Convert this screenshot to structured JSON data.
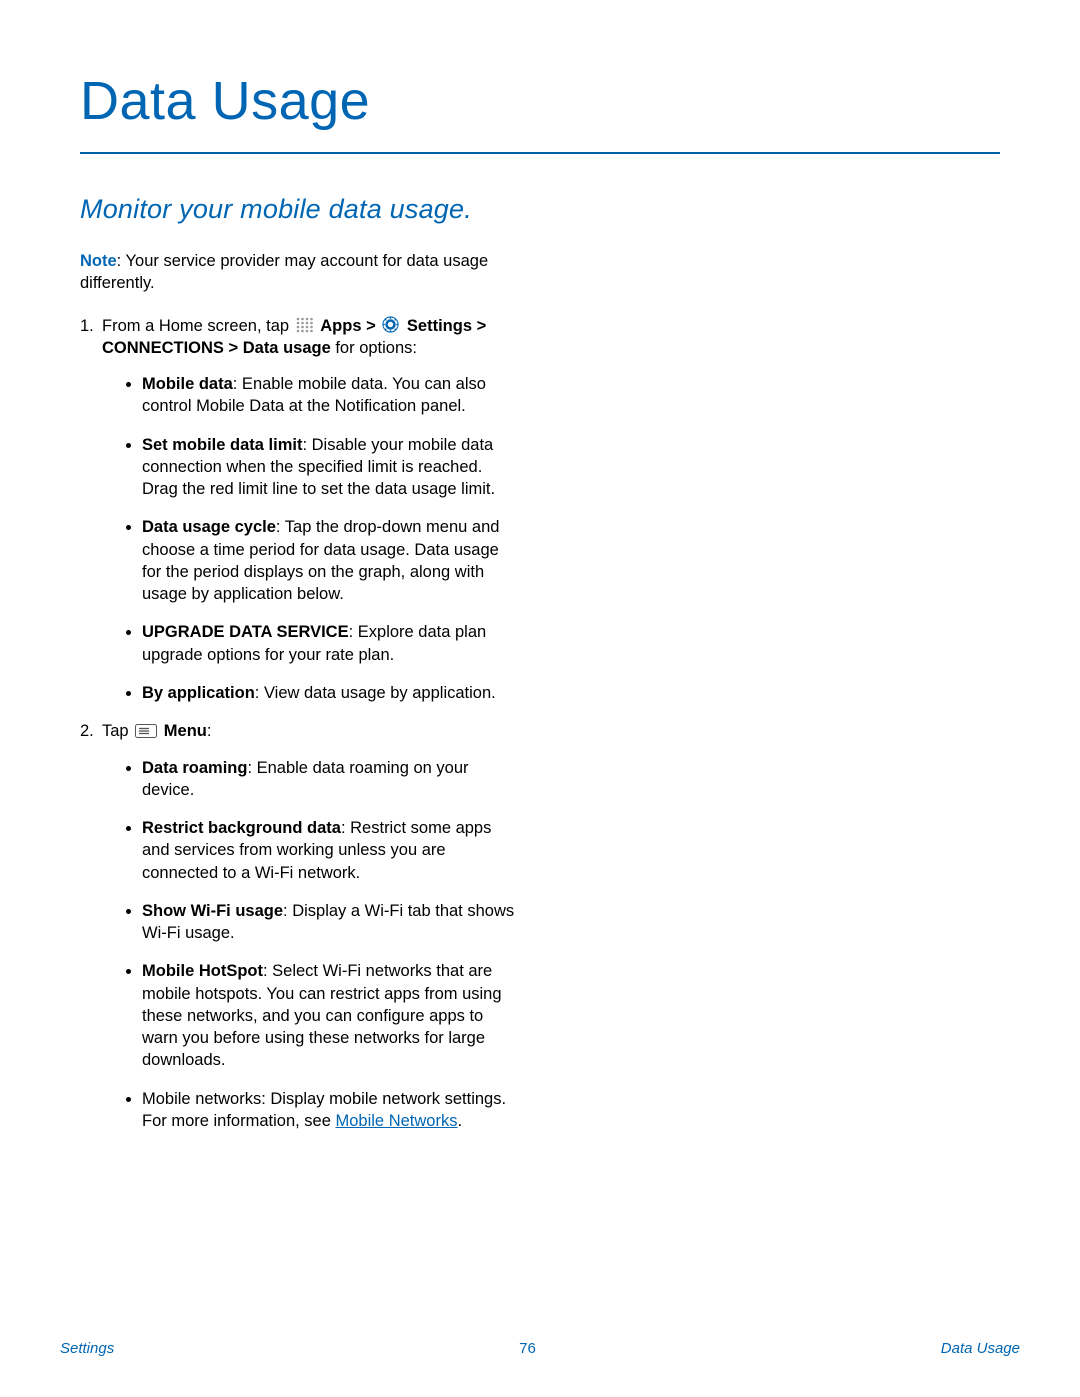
{
  "title": "Data Usage",
  "subtitle": "Monitor your mobile data usage.",
  "note_label": "Note",
  "note_text": ": Your service provider may account for data usage differently.",
  "step1": {
    "num": "1.",
    "text_before_apps": "From a Home screen, tap ",
    "apps_label": "Apps",
    "gt1": " > ",
    "settings_label": "Settings",
    "path_after": "  > CONNECTIONS > Data usage",
    "text_after": " for options:"
  },
  "step1_bullets": [
    {
      "strong": "Mobile data",
      "rest": ": Enable mobile data. You can also control Mobile Data at the Notification panel."
    },
    {
      "strong": "Set mobile data limit",
      "rest": ": Disable your mobile data connection when the specified limit is reached. Drag the red limit line to set the data usage limit."
    },
    {
      "strong": "Data usage cycle",
      "rest": ": Tap the drop-down menu and choose a time period for data usage. Data usage for the period displays on the graph, along with usage by application below."
    },
    {
      "strong": "UPGRADE DATA SERVICE",
      "rest": ": Explore data plan upgrade options for your rate plan."
    },
    {
      "strong": "By application",
      "rest": ": View data usage by application."
    }
  ],
  "step2": {
    "num": "2.",
    "text_before": "Tap ",
    "menu_label": "Menu",
    "colon": ":"
  },
  "step2_bullets": [
    {
      "strong": "Data roaming",
      "rest": ": Enable data roaming on your device."
    },
    {
      "strong": "Restrict background data",
      "rest": ": Restrict some apps and services from working unless you are connected to a Wi-Fi network."
    },
    {
      "strong": "Show Wi-Fi usage",
      "rest": ": Display a Wi-Fi tab that shows Wi-Fi usage."
    },
    {
      "strong": "Mobile HotSpot",
      "rest": ": Select Wi-Fi networks that are mobile hotspots. You can restrict apps from using these networks, and you can configure apps to warn you before using these networks for large downloads."
    },
    {
      "plain": "Mobile networks: Display mobile network settings. For more information, see ",
      "link": "Mobile Networks",
      "after": "."
    }
  ],
  "footer": {
    "left": "Settings",
    "center": "76",
    "right": "Data Usage"
  }
}
